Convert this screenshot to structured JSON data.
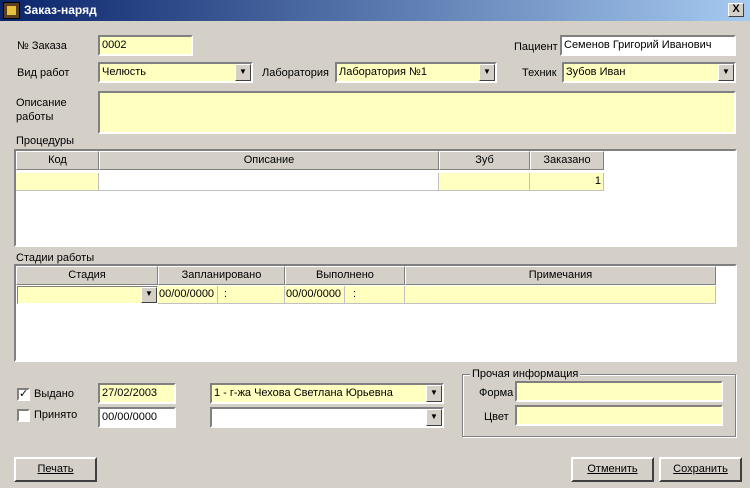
{
  "window": {
    "title": "Заказ-наряд",
    "close": "X"
  },
  "order": {
    "number_label": "№ Заказа",
    "number_value": "0002"
  },
  "patient": {
    "label": "Пациент",
    "value": "Семенов Григорий Иванович"
  },
  "work_type": {
    "label": "Вид работ",
    "value": "Челюсть"
  },
  "laboratory": {
    "label": "Лаборатория",
    "value": "Лаборатория №1"
  },
  "technician": {
    "label": "Техник",
    "value": "Зубов Иван"
  },
  "description": {
    "label": "Описание работы",
    "value": ""
  },
  "procedures": {
    "label": "Процедуры",
    "columns": [
      "Код",
      "Описание",
      "Зуб",
      "Заказано"
    ],
    "rows": [
      [
        "",
        "",
        "",
        "1"
      ]
    ]
  },
  "stages": {
    "label": "Стадии работы",
    "columns": [
      "Стадия",
      "Запланировано",
      "Выполнено",
      "Примечания"
    ],
    "rows": [
      {
        "stage": "",
        "planned_date": "00/00/0000",
        "planned_time": ":",
        "done_date": "00/00/0000",
        "done_time": ":",
        "notes": ""
      }
    ]
  },
  "issued": {
    "label": "Выдано",
    "checked": true,
    "check_mark": "✓",
    "date": "27/02/2003",
    "person": "1 - г-жа Чехова Светлана Юрьевна"
  },
  "accepted": {
    "label": "Принято",
    "checked": false,
    "check_mark": "",
    "date": "00/00/0000",
    "person": ""
  },
  "other_info": {
    "label": "Прочая информация",
    "form_label": "Форма",
    "form_value": "",
    "color_label": "Цвет",
    "color_value": ""
  },
  "buttons": {
    "print": "Печать",
    "cancel": "Отменить",
    "save": "Сохранить"
  },
  "icons": {
    "dropdown": "▼"
  }
}
